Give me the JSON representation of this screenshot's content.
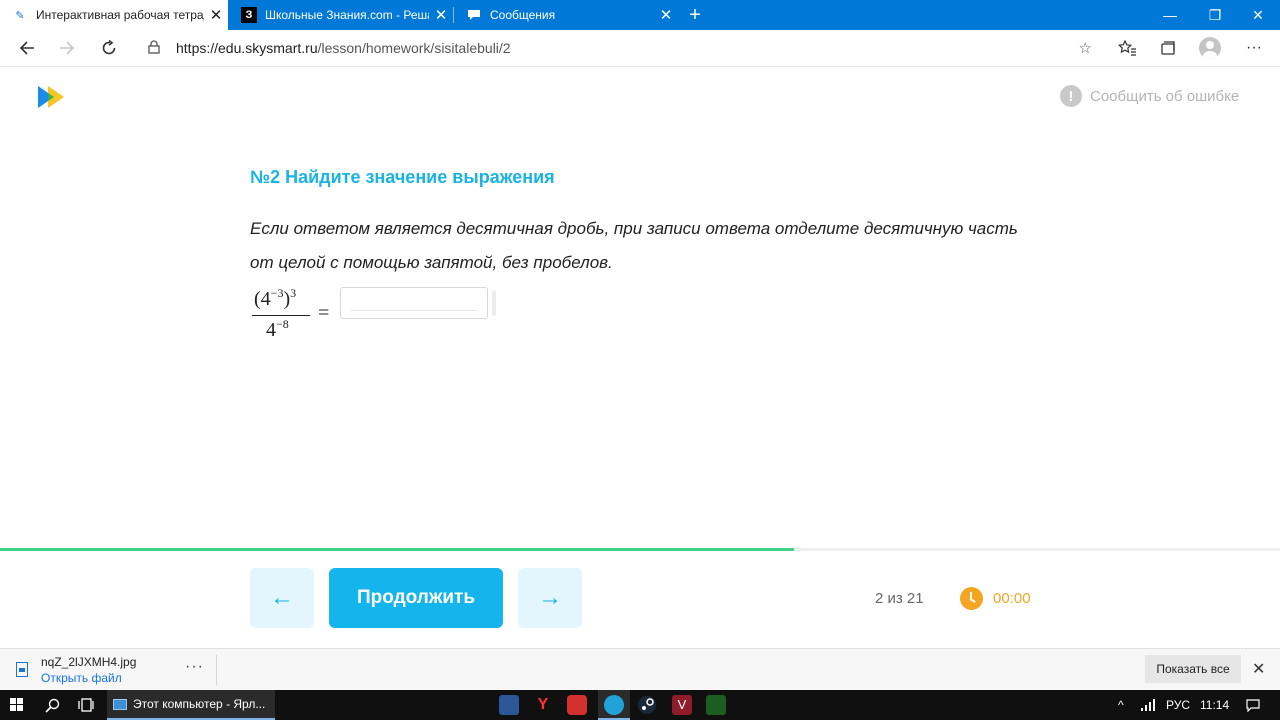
{
  "browser": {
    "tabs": [
      {
        "title": "Интерактивная рабочая тетрадь",
        "close": "✕",
        "favicon": "skysmart-icon"
      },
      {
        "title": "Школьные Знания.com - Решаем",
        "close": "✕",
        "favicon_text": "З"
      },
      {
        "title": "Сообщения",
        "close": "✕",
        "favicon": "chat-icon"
      }
    ],
    "new_tab": "+",
    "window_controls": {
      "minimize": "—",
      "restore": "❐",
      "close": "✕"
    },
    "url_host": "https://edu.skysmart.ru",
    "url_path": "/lesson/homework/sisitalebuli/2",
    "accent": "#0078d7"
  },
  "page": {
    "report_error": "Сообщить об ошибке",
    "task_title": "№2 Найдите значение выражения",
    "task_desc": "Если ответом является десятичная дробь, при записи ответа отделите десятичную часть от целой с помощью запятой, без пробелов.",
    "expression": {
      "base": "4",
      "inner_exp": "−3",
      "outer_exp": "3",
      "den_base": "4",
      "den_exp": "−8",
      "equals": "="
    },
    "answer_value": "",
    "accent": "#19b4e3"
  },
  "footer": {
    "progress": 0.62,
    "prev": "←",
    "continue": "Продолжить",
    "next": "→",
    "counter": "2 из 21",
    "timer": "00:00",
    "timer_color": "#f4a623",
    "progress_color": "#3fd38a"
  },
  "download": {
    "file": "nqZ_2lJXMH4.jpg",
    "open": "Открыть файл",
    "more": "···",
    "show_all": "Показать все",
    "close": "✕"
  },
  "taskbar": {
    "explorer": "Этот компьютер - Ярл...",
    "lang": "РУС",
    "time": "11:14"
  }
}
